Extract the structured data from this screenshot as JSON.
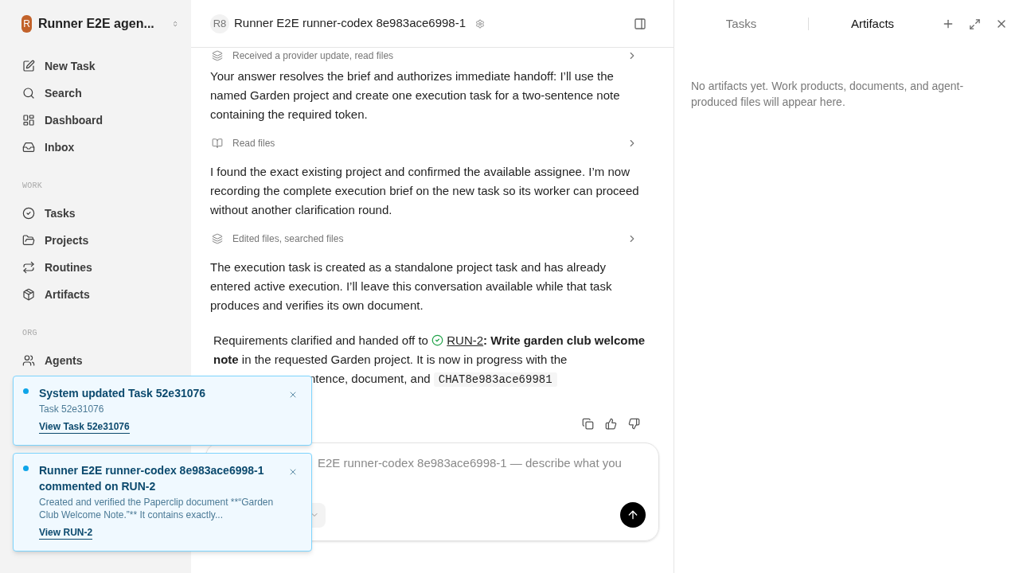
{
  "workspace": {
    "initial": "R",
    "name": "Runner E2E agen..."
  },
  "sidebar": {
    "sections": [
      {
        "items": [
          {
            "label": "New Task"
          },
          {
            "label": "Search"
          },
          {
            "label": "Dashboard"
          },
          {
            "label": "Inbox"
          }
        ]
      },
      {
        "heading": "WORK",
        "items": [
          {
            "label": "Tasks"
          },
          {
            "label": "Projects"
          },
          {
            "label": "Routines"
          },
          {
            "label": "Artifacts"
          }
        ]
      },
      {
        "heading": "ORG",
        "items": [
          {
            "label": "Agents"
          }
        ]
      }
    ]
  },
  "chat": {
    "avatar": "R8",
    "title": "Runner E2E runner-codex 8e983ace6998-1",
    "messages": [
      {
        "kind": "activity",
        "text": "Received a provider update, read files"
      },
      {
        "kind": "paragraph",
        "text": "Your answer resolves the brief and authorizes immediate handoff: I’ll use the named Garden project and create one execution task for a two-sentence note containing the required token."
      },
      {
        "kind": "activity",
        "text": "Read files"
      },
      {
        "kind": "paragraph",
        "text": "I found the exact existing project and confirmed the available assignee. I’m now recording the complete execution brief on the new task so its worker can proceed without another clarification round."
      },
      {
        "kind": "activity",
        "text": "Edited files, searched files"
      },
      {
        "kind": "paragraph",
        "text": "The execution task is created as a standalone project task and has already entered active execution. I’ll leave this conversation available while that task produces and verifies its own document."
      }
    ],
    "summary": {
      "lead": "Requirements clarified and handed off to",
      "link": "RUN-2",
      "rest": "**: Write garden club welcome note** in the requested Garden project. It is now in progress with the",
      "tail": "ntence, document, and",
      "code": "CHAT8e983ace69981"
    },
    "composer": {
      "placeholder": "E2E runner-codex 8e983ace6998-1 — describe what you"
    }
  },
  "panel": {
    "tabs": [
      {
        "label": "Tasks",
        "selected": false
      },
      {
        "label": "Artifacts",
        "selected": true
      }
    ],
    "empty": "No artifacts yet. Work products, documents, and agent-produced files will appear here."
  },
  "toasts": [
    {
      "title": "System updated Task 52e31076",
      "body": "Task 52e31076",
      "link": "View Task 52e31076"
    },
    {
      "title": "Runner E2E runner-codex 8e983ace6998-1 commented on RUN-2",
      "body": "Created and verified the Paperclip document **“Garden Club Welcome Note.”** It contains exactly...",
      "link": "View RUN-2"
    }
  ]
}
